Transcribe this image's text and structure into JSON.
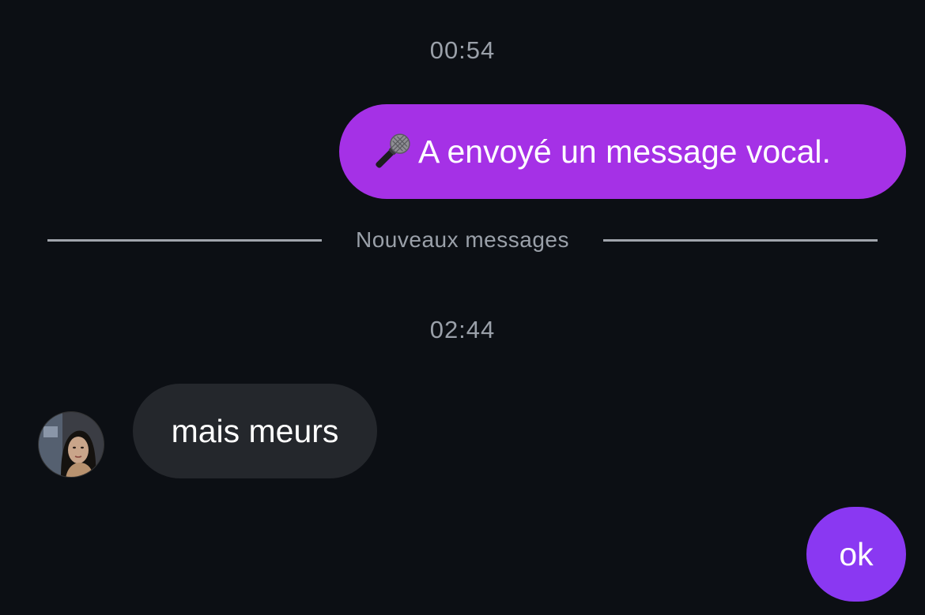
{
  "conversation": {
    "timestamp_1": "00:54",
    "timestamp_2": "02:44",
    "new_messages_divider": "Nouveaux messages",
    "messages": [
      {
        "direction": "outgoing",
        "icon": "microphone-icon",
        "text": "A envoyé un message vocal.",
        "bubble_color": "#a531e6"
      },
      {
        "direction": "incoming",
        "text": "mais meurs",
        "bubble_color": "#24272c"
      },
      {
        "direction": "outgoing",
        "text": "ok",
        "bubble_color": "#8a38f2"
      }
    ]
  },
  "colors": {
    "background": "#0c0f14",
    "timestamp_text": "#9aa0a9",
    "divider_line": "#a0a4ac"
  }
}
